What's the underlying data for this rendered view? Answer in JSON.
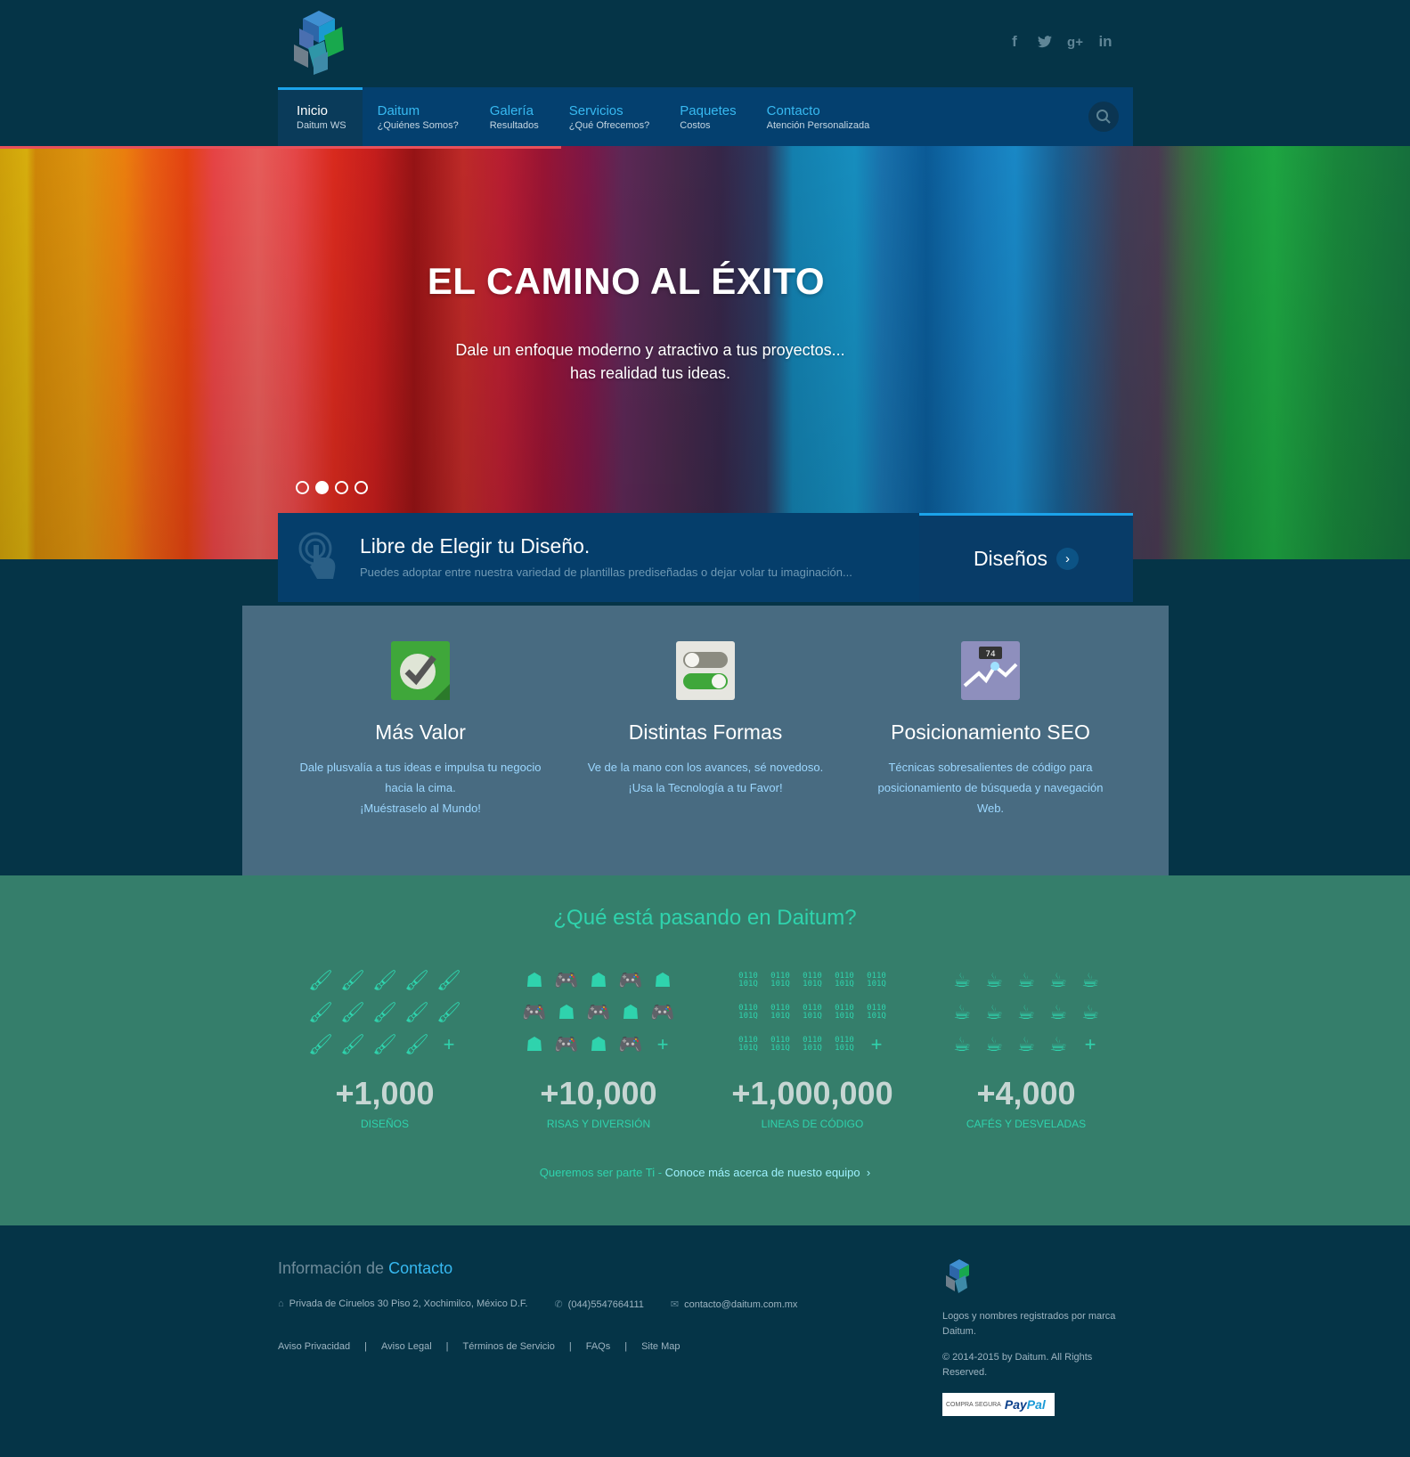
{
  "header": {
    "social": [
      "facebook-icon",
      "twitter-icon",
      "google-plus-icon",
      "linkedin-icon"
    ]
  },
  "nav": {
    "items": [
      {
        "title": "Inicio",
        "sub": "Daitum WS"
      },
      {
        "title": "Daitum",
        "sub": "¿Quiénes Somos?"
      },
      {
        "title": "Galería",
        "sub": "Resultados"
      },
      {
        "title": "Servicios",
        "sub": "¿Qué Ofrecemos?"
      },
      {
        "title": "Paquetes",
        "sub": "Costos"
      },
      {
        "title": "Contacto",
        "sub": "Atención Personalizada"
      }
    ],
    "active_index": 0
  },
  "hero": {
    "title": "EL CAMINO AL ÉXITO",
    "line1": "Dale un enfoque moderno y atractivo a tus proyectos...",
    "line2": "has realidad tus ideas.",
    "slides": 4,
    "active_slide": 2
  },
  "promo": {
    "title": "Libre de Elegir tu Diseño.",
    "subtitle": "Puedes adoptar entre nuestra variedad de plantillas prediseñadas o dejar volar tu imaginación...",
    "button": "Diseños"
  },
  "features": [
    {
      "title": "Más Valor",
      "lines": [
        "Dale plusvalía a tus ideas e impulsa tu negocio",
        "hacia la cima.",
        "¡Muéstraselo al Mundo!"
      ]
    },
    {
      "title": "Distintas Formas",
      "lines": [
        "Ve de la mano con los avances, sé novedoso.",
        "¡Usa la Tecnología a tu Favor!"
      ]
    },
    {
      "title": "Posicionamiento SEO",
      "lines": [
        "Técnicas sobresalientes de código para",
        "posicionamiento de búsqueda y navegación",
        "Web."
      ]
    }
  ],
  "stats": {
    "heading": "¿Qué está pasando en Daitum?",
    "items": [
      {
        "number": "+1,000",
        "label": "DISEÑOS",
        "icon": "brush-icon"
      },
      {
        "number": "+10,000",
        "label": "RISAS Y DIVERSIÓN",
        "icon": "gamepad-icon"
      },
      {
        "number": "+1,000,000",
        "label": "LINEAS DE CÓDIGO",
        "icon": "binary-icon"
      },
      {
        "number": "+4,000",
        "label": "CAFÉS Y DESVELADAS",
        "icon": "coffee-icon"
      }
    ],
    "more_text": "Queremos ser parte Ti - ",
    "more_link": "Conoce más acerca de nuesto equipo"
  },
  "footer": {
    "title_a": "Información de ",
    "title_b": "Contacto",
    "address": "Privada de Ciruelos 30 Piso 2, Xochimilco, México D.F.",
    "phone": "(044)5547664111",
    "email": "contacto@daitum.com.mx",
    "links": [
      "Aviso Privacidad",
      "Aviso Legal",
      "Términos de Servicio",
      "FAQs",
      "Site Map"
    ],
    "legal1": "Logos y nombres registrados por marca Daitum.",
    "legal2": "© 2014-2015 by Daitum. All Rights Reserved.",
    "paypal_small": "COMPRA SEGURA",
    "paypal_a": "Pay",
    "paypal_b": "Pal"
  }
}
